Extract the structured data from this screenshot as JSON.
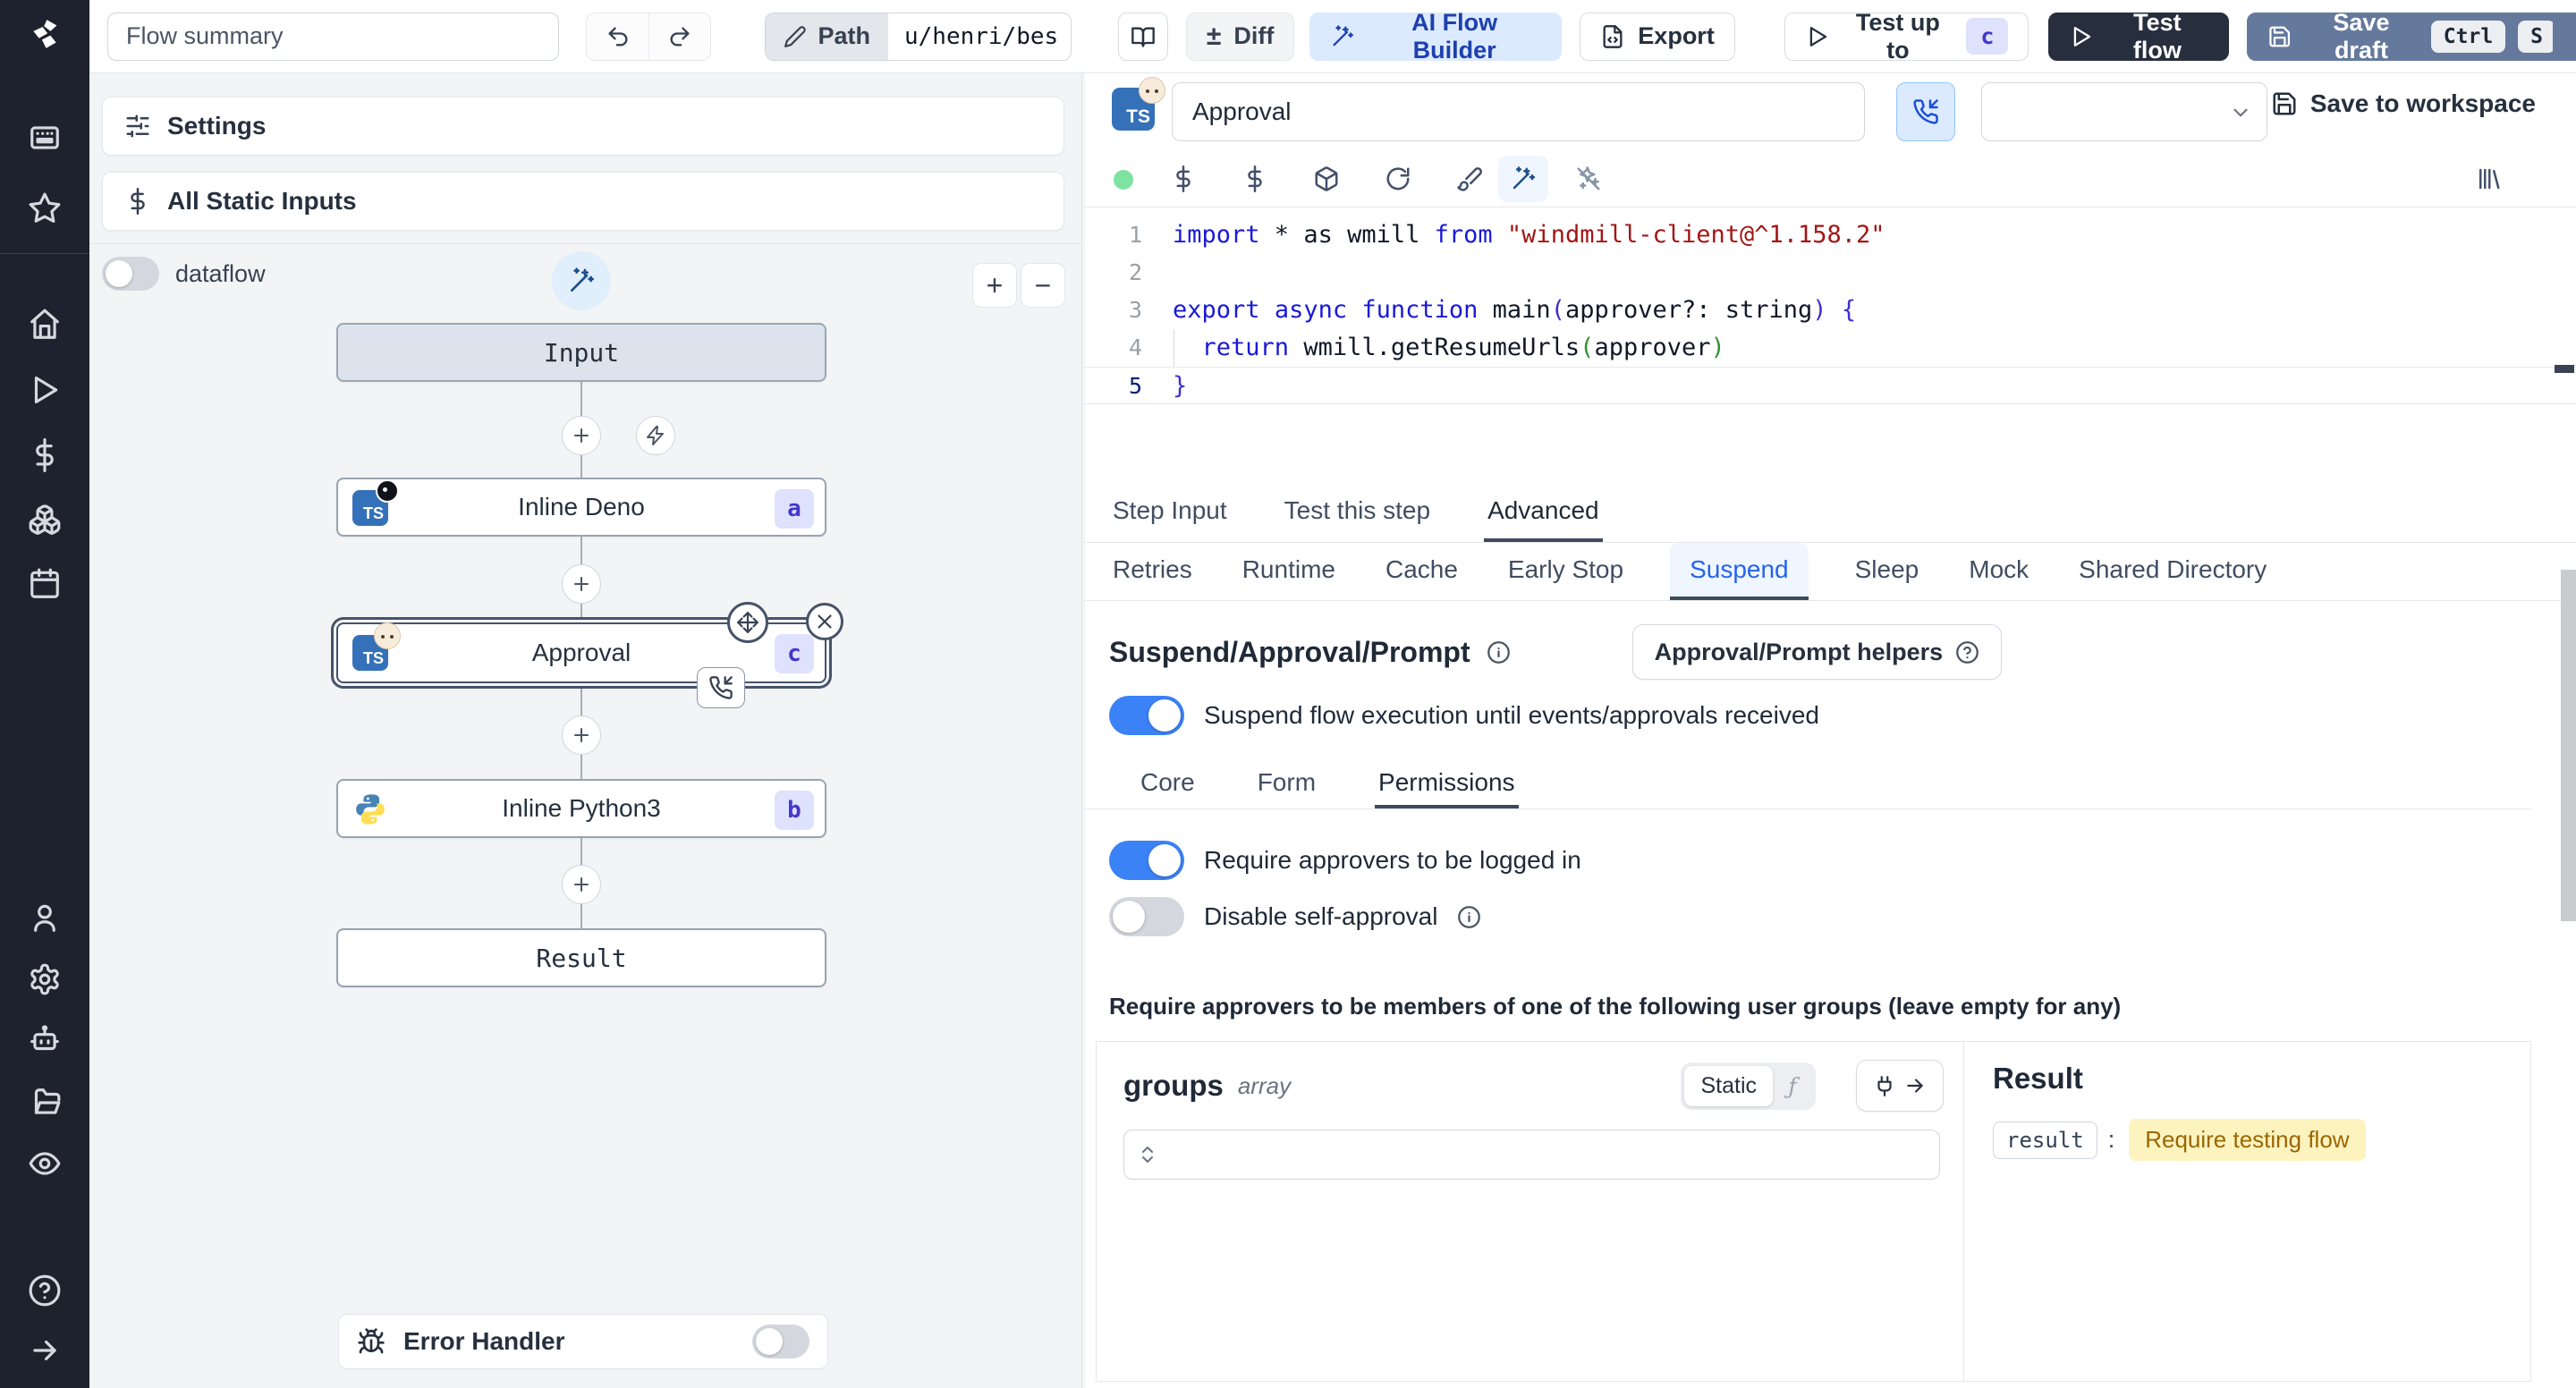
{
  "topbar": {
    "flow_summary_value": "Flow summary",
    "path_label": "Path",
    "path_value": "u/henri/bes",
    "diff_symbol": "±",
    "diff_label": "Diff",
    "ai_flow_builder_label": "AI Flow Builder",
    "export_label": "Export",
    "test_up_to_label": "Test up to",
    "test_up_to_badge": "c",
    "test_flow_label": "Test flow",
    "save_draft_label": "Save draft",
    "kbd_ctrl": "Ctrl",
    "kbd_s": "S"
  },
  "left_panel": {
    "settings_label": "Settings",
    "all_static_inputs_label": "All Static Inputs",
    "dataflow_label": "dataflow",
    "error_handler_label": "Error Handler"
  },
  "graph": {
    "ts_badge": "TS",
    "nodes": {
      "input": {
        "label": "Input"
      },
      "deno": {
        "label": "Inline Deno",
        "badge": "a"
      },
      "approval": {
        "label": "Approval",
        "badge": "c"
      },
      "python": {
        "label": "Inline Python3",
        "badge": "b"
      },
      "result": {
        "label": "Result"
      }
    }
  },
  "step_header": {
    "ts_badge": "TS",
    "name_value": "Approval",
    "save_to_workspace_label": "Save to workspace"
  },
  "editor": {
    "line_numbers": [
      "1",
      "2",
      "3",
      "4",
      "5"
    ],
    "lines": [
      {
        "tokens": [
          {
            "t": "import",
            "c": "kw"
          },
          {
            "t": " * as wmill ",
            "c": "pl"
          },
          {
            "t": "from",
            "c": "kw"
          },
          {
            "t": " ",
            "c": "pl"
          },
          {
            "t": "\"windmill-client@^1.158.2\"",
            "c": "str"
          }
        ]
      },
      {
        "tokens": []
      },
      {
        "tokens": [
          {
            "t": "export",
            "c": "kw"
          },
          {
            "t": " ",
            "c": "pl"
          },
          {
            "t": "async",
            "c": "kw"
          },
          {
            "t": " ",
            "c": "pl"
          },
          {
            "t": "function",
            "c": "kw"
          },
          {
            "t": " main",
            "c": "pl"
          },
          {
            "t": "(",
            "c": "br1"
          },
          {
            "t": "approver?: string",
            "c": "pl"
          },
          {
            "t": ")",
            "c": "br1"
          },
          {
            "t": " ",
            "c": "pl"
          },
          {
            "t": "{",
            "c": "br1"
          }
        ]
      },
      {
        "tokens": [
          {
            "t": "  ",
            "c": "pl"
          },
          {
            "t": "return",
            "c": "kw"
          },
          {
            "t": " wmill.getResumeUrls",
            "c": "pl"
          },
          {
            "t": "(",
            "c": "br2"
          },
          {
            "t": "approver",
            "c": "pl"
          },
          {
            "t": ")",
            "c": "br2"
          }
        ]
      },
      {
        "tokens": [
          {
            "t": "}",
            "c": "br1"
          }
        ]
      }
    ]
  },
  "tabs": {
    "main": [
      {
        "label": "Step Input"
      },
      {
        "label": "Test this step"
      },
      {
        "label": "Advanced"
      }
    ],
    "advanced": [
      {
        "label": "Retries"
      },
      {
        "label": "Runtime"
      },
      {
        "label": "Cache"
      },
      {
        "label": "Early Stop"
      },
      {
        "label": "Suspend"
      },
      {
        "label": "Sleep"
      },
      {
        "label": "Mock"
      },
      {
        "label": "Shared Directory"
      }
    ]
  },
  "suspend": {
    "title": "Suspend/Approval/Prompt",
    "helpers_label": "Approval/Prompt helpers",
    "suspend_toggle_label": "Suspend flow execution until events/approvals received",
    "sub_tabs": [
      {
        "label": "Core"
      },
      {
        "label": "Form"
      },
      {
        "label": "Permissions"
      }
    ],
    "require_login_label": "Require approvers to be logged in",
    "disable_self_approval_label": "Disable self-approval",
    "groups_hint": "Require approvers to be members of one of the following user groups (leave empty for any)"
  },
  "groups_editor": {
    "name": "groups",
    "type": "array",
    "static_label": "Static",
    "fx_symbol": "ƒ"
  },
  "result_panel": {
    "title": "Result",
    "key": "result",
    "colon": ":",
    "value": "Require testing flow"
  },
  "colors": {
    "accent_blue": "#3b82f6",
    "badge_bg": "#dee2fd",
    "badge_text": "#4338ca",
    "save_draft_bg": "#64799c",
    "dark_button_bg": "#272e3d",
    "ai_button_bg": "#dbeafe",
    "ai_button_text": "#1e40af",
    "yellow_chip_bg": "#fdf3bf",
    "yellow_chip_text": "#9a6700",
    "sidebar_bg": "#1d222e",
    "code_keyword": "#1a1ad6",
    "code_string": "#a31515"
  }
}
